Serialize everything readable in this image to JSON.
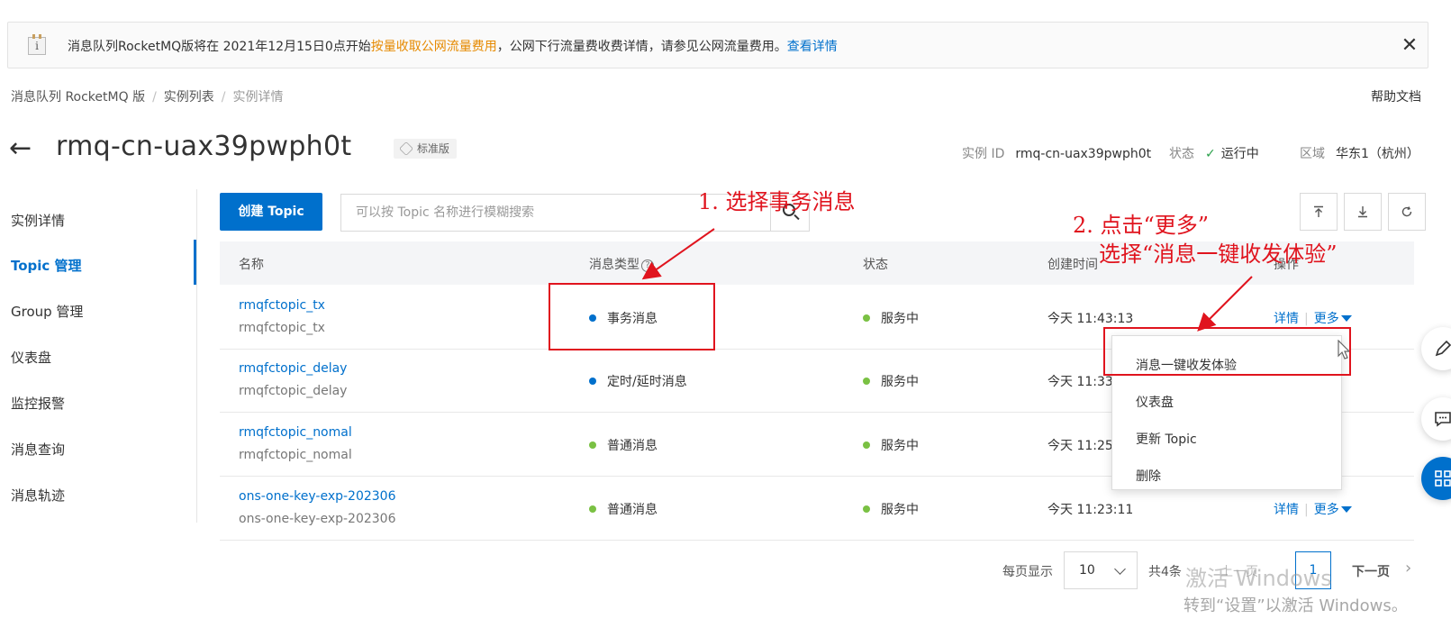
{
  "notice": {
    "text_before": "消息队列RocketMQ版将在 2021年12月15日0点开始",
    "link_highlight": "按量收取公网流量费用",
    "text_after": "，公网下行流量费收费详情，请参见公网流量费用。",
    "details_link": "查看详情",
    "close": "✕"
  },
  "breadcrumb": [
    "消息队列 RocketMQ 版",
    "实例列表",
    "实例详情"
  ],
  "help_doc": "帮助文档",
  "header": {
    "back": "←",
    "title": "rmq-cn-uax39pwph0t",
    "edition": "标准版",
    "instance_id_label": "实例 ID",
    "instance_id": "rmq-cn-uax39pwph0t",
    "status_label": "状态",
    "status": "运行中",
    "region_label": "区域",
    "region": "华东1（杭州）"
  },
  "sidebar": {
    "items": [
      "实例详情",
      "Topic 管理",
      "Group 管理",
      "仪表盘",
      "监控报警",
      "消息查询",
      "消息轨迹"
    ],
    "active_index": 1
  },
  "toolbar": {
    "create_button": "创建 Topic",
    "search_placeholder": "可以按 Topic 名称进行模糊搜索"
  },
  "table": {
    "headers": [
      "名称",
      "消息类型",
      "状态",
      "创建时间",
      "操作"
    ],
    "rows": [
      {
        "name": "rmqfctopic_tx",
        "sub": "rmqfctopic_tx",
        "type": "事务消息",
        "type_color": "#0070cc",
        "status": "服务中",
        "created": "今天 11:43:13"
      },
      {
        "name": "rmqfctopic_delay",
        "sub": "rmqfctopic_delay",
        "type": "定时/延时消息",
        "type_color": "#0070cc",
        "status": "服务中",
        "created": "今天 11:33"
      },
      {
        "name": "rmqfctopic_nomal",
        "sub": "rmqfctopic_nomal",
        "type": "普通消息",
        "type_color": "#7ac143",
        "status": "服务中",
        "created": "今天 11:25"
      },
      {
        "name": "ons-one-key-exp-202306",
        "sub": "ons-one-key-exp-202306",
        "type": "普通消息",
        "type_color": "#7ac143",
        "status": "服务中",
        "created": "今天 11:23:11"
      }
    ],
    "status_color": "#7ac143",
    "details_label": "详情",
    "more_label": "更多"
  },
  "dropdown": [
    "消息一键收发体验",
    "仪表盘",
    "更新 Topic",
    "删除"
  ],
  "pagination": {
    "per_page_label": "每页显示",
    "per_page": "10",
    "total": "共4条",
    "prev": "上一页",
    "current_page": "1",
    "next": "下一页"
  },
  "annotations": {
    "step1": "1. 选择事务消息",
    "step2_line1": "2. 点击“更多”",
    "step2_line2": "选择“消息一键收发体验”"
  },
  "watermark": {
    "line1": "激活 Windows",
    "line2": "转到“设置”以激活 Windows。"
  },
  "colors": {
    "primary": "#0070cc",
    "annotation_red": "#e0141e",
    "success_green": "#7ac143",
    "notice_orange": "#e68a00"
  }
}
